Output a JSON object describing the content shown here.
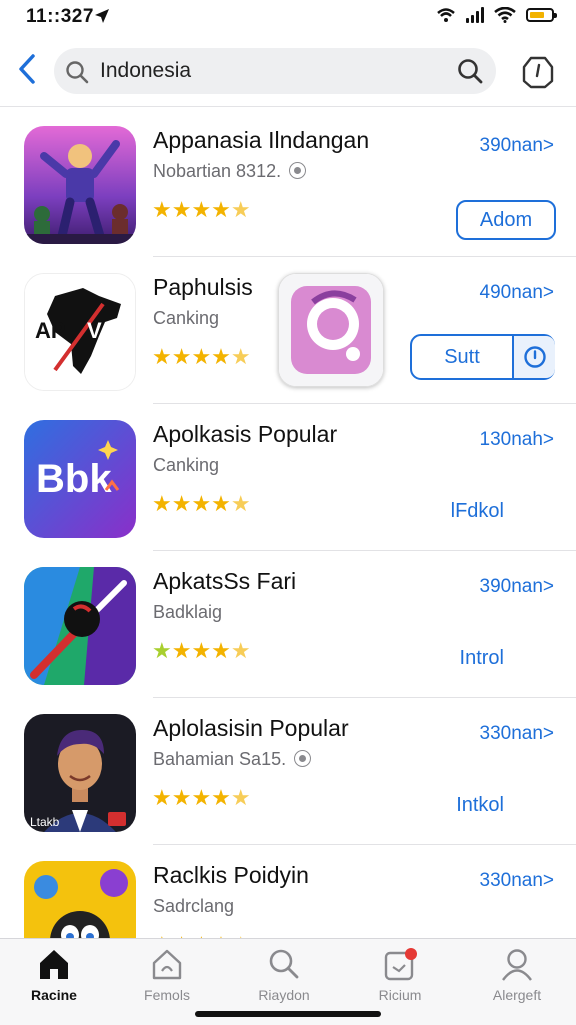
{
  "status_bar": {
    "time": "11::327"
  },
  "search": {
    "query": "Indonesia"
  },
  "apps": [
    {
      "title": "Appanasia Ilndangan",
      "subtitle": "Nobartian 8312.",
      "size": "390nan>",
      "action": "Adom",
      "action_type": "button",
      "rating": 4.5,
      "icon": "game-character-icon"
    },
    {
      "title": "Paphulsis",
      "subtitle": "Canking",
      "size": "490nan>",
      "action": "Sutt",
      "action_type": "split-button",
      "rating": 4.5,
      "icon": "africa-map-icon"
    },
    {
      "title": "Apolkasis Popular",
      "subtitle": "Canking",
      "size": "130nah>",
      "action": "lFdkol",
      "action_type": "link",
      "rating": 4.5,
      "icon": "bbk-logo-icon"
    },
    {
      "title": "ApkatsSs Fari",
      "subtitle": "Badklaig",
      "size": "390nan>",
      "action": "Introl",
      "action_type": "link",
      "rating": 4.5,
      "icon": "compass-icon"
    },
    {
      "title": "Aplolasisin Popular",
      "subtitle": "Bahamian Sa15.",
      "size": "330nan>",
      "action": "Intkol",
      "action_type": "link",
      "rating": 4.5,
      "icon": "portrait-icon"
    },
    {
      "title": "Raclkis Poidyin",
      "subtitle": "Sadrclang",
      "size": "330nan>",
      "action": "",
      "action_type": "none",
      "rating": 4.5,
      "icon": "cartoon-icon"
    }
  ],
  "tabs": [
    {
      "label": "Racine",
      "icon": "home-icon",
      "active": true
    },
    {
      "label": "Femols",
      "icon": "house-outline-icon",
      "active": false
    },
    {
      "label": "Riaydon",
      "icon": "search-icon",
      "active": false
    },
    {
      "label": "Ricium",
      "icon": "updates-icon",
      "active": false,
      "badge": true
    },
    {
      "label": "Alergeft",
      "icon": "profile-icon",
      "active": false
    }
  ],
  "colors": {
    "accent": "#1e6fd9",
    "star": "#f3b300",
    "badge": "#e53935"
  }
}
